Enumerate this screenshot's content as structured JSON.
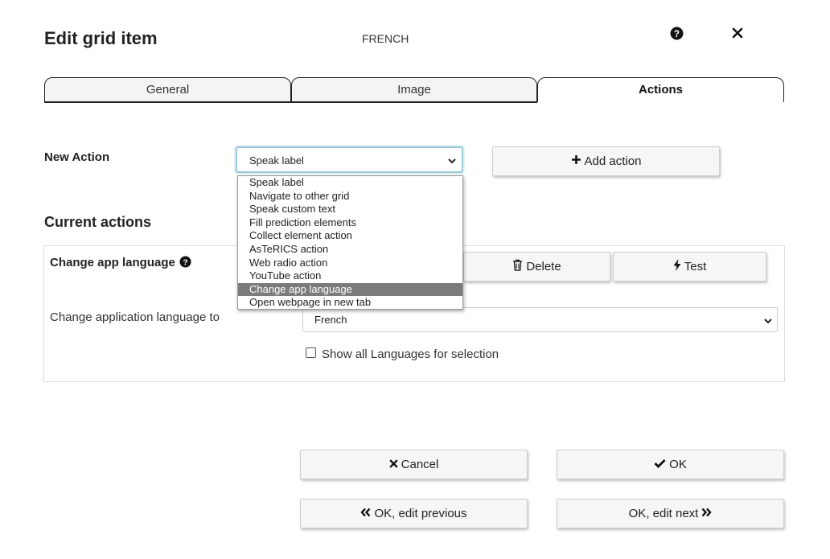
{
  "header": {
    "title": "Edit grid item",
    "grid_name": "FRENCH",
    "help_icon": "question-circle-icon",
    "close_icon": "close-icon"
  },
  "tabs": [
    {
      "label": "General",
      "active": false
    },
    {
      "label": "Image",
      "active": false
    },
    {
      "label": "Actions",
      "active": true
    }
  ],
  "new_action": {
    "label": "New Action",
    "selected": "Speak label",
    "add_button_label": "Add action",
    "options": [
      "Speak label",
      "Navigate to other grid",
      "Speak custom text",
      "Fill prediction elements",
      "Collect element action",
      "AsTeRICS action",
      "Web radio action",
      "YouTube action",
      "Change app language",
      "Open webpage in new tab"
    ],
    "highlighted_option": "Change app language"
  },
  "current_actions": {
    "heading": "Current actions",
    "item": {
      "name": "Change app language",
      "delete_label": "Delete",
      "test_label": "Test",
      "language_label": "Change application language to",
      "language_value": "French",
      "show_all_label": "Show all Languages for selection",
      "show_all_checked": false
    }
  },
  "footer": {
    "cancel_label": "Cancel",
    "ok_label": "OK",
    "ok_prev_label": "OK, edit previous",
    "ok_next_label": "OK, edit next"
  },
  "colors": {
    "focus_border": "#9cc9d6",
    "highlight_bg": "#7b7b7b",
    "button_bg": "#f6f6f6"
  }
}
